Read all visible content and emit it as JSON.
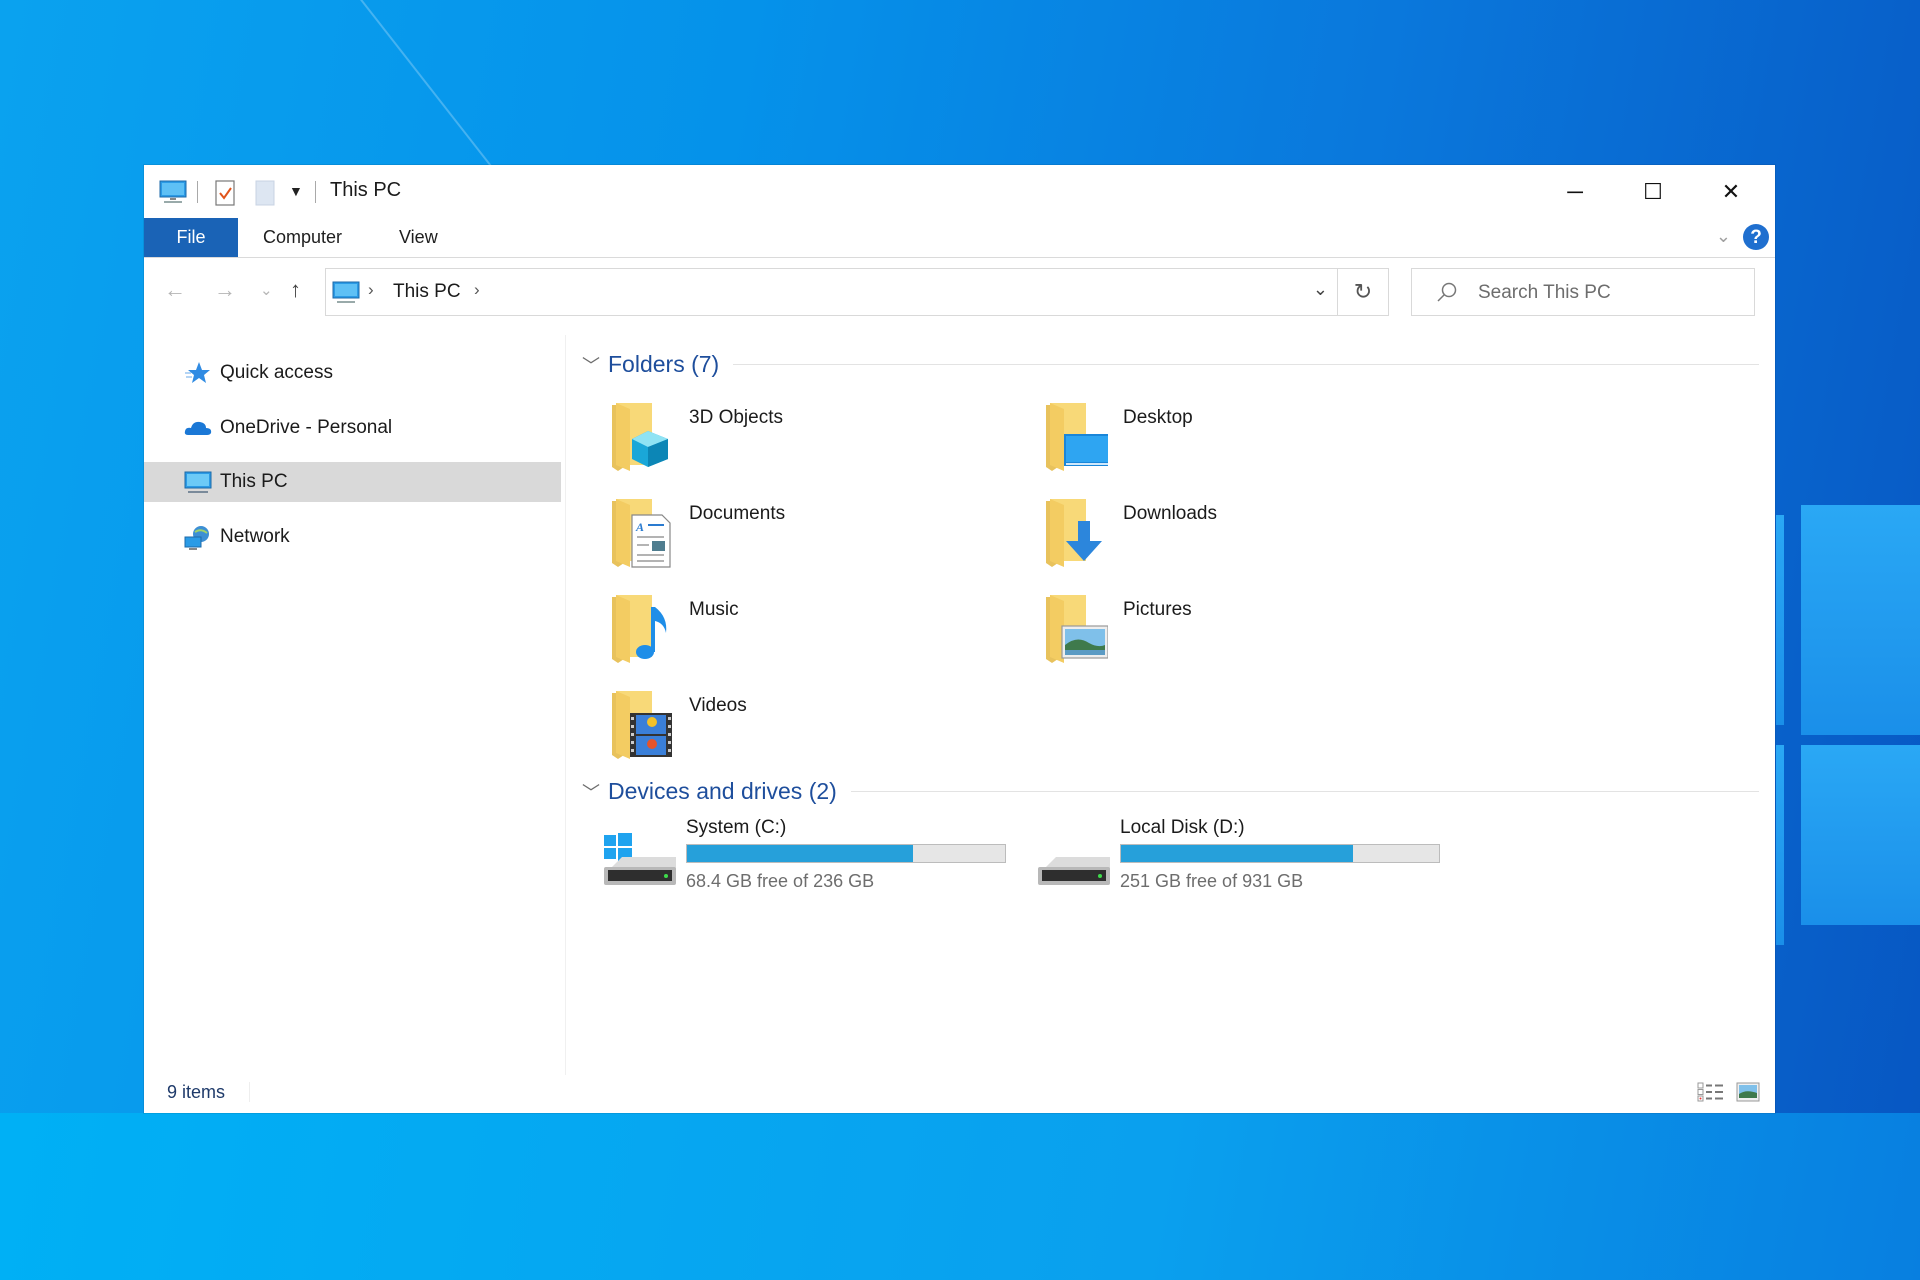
{
  "desktop": {
    "accent": "#0a8ae6"
  },
  "window": {
    "title": "This PC",
    "quick_access_toolbar": [
      "this-pc-icon",
      "properties-icon",
      "new-folder-icon",
      "customize-dropdown-icon"
    ],
    "controls": {
      "minimize": "─",
      "maximize": "☐",
      "close": "✕"
    }
  },
  "ribbon": {
    "tabs": [
      {
        "label": "File",
        "active": true
      },
      {
        "label": "Computer"
      },
      {
        "label": "View"
      }
    ],
    "expand_icon": "⌄",
    "help_label": "?"
  },
  "address_bar": {
    "back": "←",
    "forward": "→",
    "recent": "⌄",
    "up": "↑",
    "crumbs": [
      "This PC"
    ],
    "separator": "›",
    "dropdown": "⌄",
    "refresh": "↻"
  },
  "search": {
    "placeholder": "Search This PC",
    "value": ""
  },
  "nav_pane": {
    "items": [
      {
        "label": "Quick access",
        "icon": "star-icon"
      },
      {
        "label": "OneDrive - Personal",
        "icon": "cloud-icon"
      },
      {
        "label": "This PC",
        "icon": "computer-icon",
        "selected": true
      },
      {
        "label": "Network",
        "icon": "network-icon"
      }
    ]
  },
  "content": {
    "folders_header": "Folders (7)",
    "folders": [
      {
        "name": "3D Objects",
        "icon": "3d-objects-folder-icon"
      },
      {
        "name": "Desktop",
        "icon": "desktop-folder-icon"
      },
      {
        "name": "Documents",
        "icon": "documents-folder-icon"
      },
      {
        "name": "Downloads",
        "icon": "downloads-folder-icon"
      },
      {
        "name": "Music",
        "icon": "music-folder-icon"
      },
      {
        "name": "Pictures",
        "icon": "pictures-folder-icon"
      },
      {
        "name": "Videos",
        "icon": "videos-folder-icon"
      }
    ],
    "drives_header": "Devices and drives (2)",
    "drives": [
      {
        "name": "System (C:)",
        "free_text": "68.4 GB free of 236 GB",
        "used_fraction": 0.71,
        "icon": "system-drive-icon"
      },
      {
        "name": "Local Disk (D:)",
        "free_text": "251 GB free of 931 GB",
        "used_fraction": 0.73,
        "icon": "local-disk-icon"
      }
    ],
    "bar_color": "#26a0da"
  },
  "status_bar": {
    "item_count": "9 items"
  }
}
